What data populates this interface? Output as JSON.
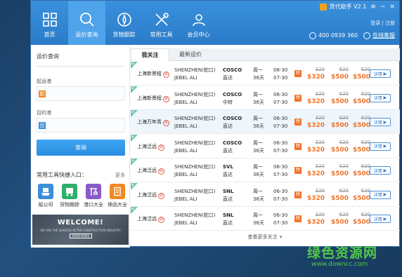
{
  "window": {
    "title": "货代助手 V2.1",
    "login": "登录 | 注册",
    "phone": "400 0939 360",
    "service": "在线客服"
  },
  "nav": [
    {
      "label": "首页",
      "icon": "home-grid-icon"
    },
    {
      "label": "运价查询",
      "icon": "search-icon"
    },
    {
      "label": "货物跟踪",
      "icon": "compass-icon"
    },
    {
      "label": "常用工具",
      "icon": "tools-icon"
    },
    {
      "label": "会员中心",
      "icon": "member-icon"
    }
  ],
  "left": {
    "title": "运价查询",
    "origin_label": "起运港",
    "origin_icon_text": "起",
    "dest_label": "目的港",
    "dest_icon_text": "目",
    "query_button": "查询",
    "tools_title": "常用工具快捷入口：",
    "tools_more": "更多",
    "tools": [
      {
        "label": "船公司",
        "icon": "ship-company-icon",
        "color": "#3a8fd8"
      },
      {
        "label": "货物跟踪",
        "icon": "truck-icon",
        "color": "#2fae6d"
      },
      {
        "label": "港口大全",
        "icon": "crane-icon",
        "color": "#8a5ac8"
      },
      {
        "label": "保函大全",
        "icon": "document-icon",
        "color": "#f08a24"
      }
    ],
    "banner_title": "WELCOME!",
    "banner_sub": "WE ARE THE LEADERS IN THE CONSTRUCTION INDUSTRY",
    "banner_button": "READ MORE"
  },
  "tabs": [
    "我关注",
    "最新运价"
  ],
  "table": {
    "rows": [
      {
        "badge": "新",
        "name": "上海新景程",
        "route": [
          "SHENZHEN(蛇口)",
          "JEBEL ALI"
        ],
        "carrier": [
          "COSCO",
          "直达"
        ],
        "days": [
          "周一",
          "36天"
        ],
        "dates": [
          "06-30",
          "07-30"
        ],
        "spec": "特",
        "prices": [
          {
            "old": "320",
            "new": "$320"
          },
          {
            "old": "620",
            "new": "$500"
          },
          {
            "old": "620",
            "new": "$500"
          }
        ],
        "detail": "详情",
        "highlight": false
      },
      {
        "badge": "新",
        "name": "上海新景程",
        "route": [
          "SHENZHEN(蛇口)",
          "JEBEL ALI"
        ],
        "carrier": [
          "COSCO",
          "中转"
        ],
        "days": [
          "周一",
          "36天"
        ],
        "dates": [
          "06-30",
          "07-30"
        ],
        "spec": "特",
        "prices": [
          {
            "old": "320",
            "new": "$320"
          },
          {
            "old": "620",
            "new": "$500"
          },
          {
            "old": "620",
            "new": "$500"
          }
        ],
        "detail": "详情",
        "highlight": false
      },
      {
        "badge": "新",
        "name": "上海万年青",
        "route": [
          "SHENZHEN(蛇口)",
          "JEBEL ALI"
        ],
        "carrier": [
          "COSCO",
          "直达"
        ],
        "days": [
          "周一",
          "36天"
        ],
        "dates": [
          "06-30",
          "07-30"
        ],
        "spec": "特",
        "prices": [
          {
            "old": "320",
            "new": "$320"
          },
          {
            "old": "620",
            "new": "$500"
          },
          {
            "old": "620",
            "new": "$500"
          }
        ],
        "detail": "详情",
        "highlight": true
      },
      {
        "badge": "新",
        "name": "上海泛远",
        "route": [
          "SHENZHEN(蛇口)",
          "JEBEL ALI"
        ],
        "carrier": [
          "COSCO",
          "直达"
        ],
        "days": [
          "周一",
          "36天"
        ],
        "dates": [
          "06-30",
          "07-30"
        ],
        "spec": "特",
        "prices": [
          {
            "old": "320",
            "new": "$320"
          },
          {
            "old": "620",
            "new": "$500"
          },
          {
            "old": "620",
            "new": "$500"
          }
        ],
        "detail": "详情",
        "highlight": false
      },
      {
        "badge": "新",
        "name": "上海泛远",
        "route": [
          "SHENZHEN(蛇口)",
          "JEBEL ALI"
        ],
        "carrier": [
          "SVL",
          "直达"
        ],
        "days": [
          "周一",
          "36天"
        ],
        "dates": [
          "06-30",
          "07-30"
        ],
        "spec": "特",
        "prices": [
          {
            "old": "320",
            "new": "$320"
          },
          {
            "old": "620",
            "new": "$500"
          },
          {
            "old": "620",
            "new": "$500"
          }
        ],
        "detail": "详情",
        "highlight": false
      },
      {
        "badge": "新",
        "name": "上海泛远",
        "route": [
          "SHENZHEN(蛇口)",
          "JEBEL ALI"
        ],
        "carrier": [
          "SNL",
          "直达"
        ],
        "days": [
          "周一",
          "36天"
        ],
        "dates": [
          "06-30",
          "07-30"
        ],
        "spec": "特",
        "prices": [
          {
            "old": "320",
            "new": "$320"
          },
          {
            "old": "620",
            "new": "$500"
          },
          {
            "old": "620",
            "new": "$500"
          }
        ],
        "detail": "详情",
        "highlight": false
      },
      {
        "badge": "新",
        "name": "上海泛远",
        "route": [
          "SHENZHEN(蛇口)",
          "JEBEL ALI"
        ],
        "carrier": [
          "SNL",
          "直达"
        ],
        "days": [
          "周一",
          "36天"
        ],
        "dates": [
          "06-30",
          "07-30"
        ],
        "spec": "特",
        "prices": [
          {
            "old": "320",
            "new": "$320"
          },
          {
            "old": "620",
            "new": "$500"
          },
          {
            "old": "620",
            "new": "$500"
          }
        ],
        "detail": "详情",
        "highlight": false
      }
    ],
    "more_link": "查看更多关注 +"
  },
  "watermark": {
    "title": "绿色资源网",
    "url": "www.downcc.com"
  }
}
